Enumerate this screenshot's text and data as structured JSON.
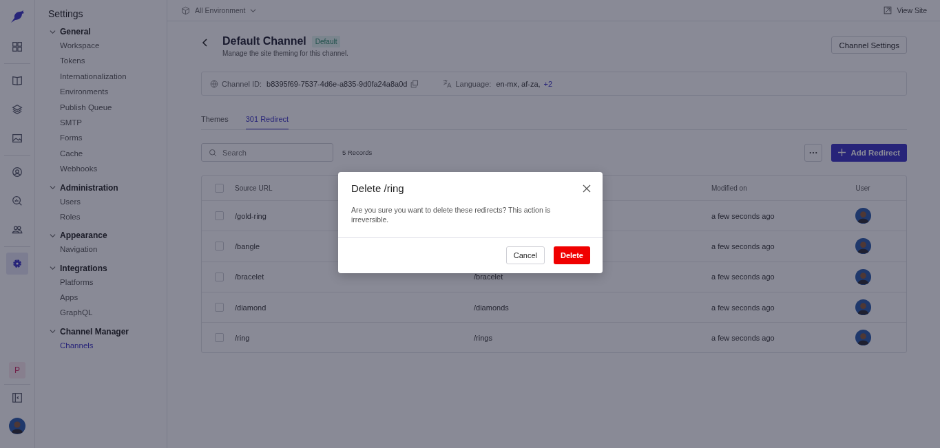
{
  "rail": [
    {
      "kind": "grid",
      "selected": false
    },
    {
      "kind": "book",
      "selected": false
    },
    {
      "kind": "layers",
      "selected": false
    },
    {
      "kind": "image",
      "selected": false
    },
    {
      "kind": "user-circle",
      "selected": false
    },
    {
      "kind": "search-chart",
      "selected": false
    },
    {
      "kind": "users",
      "selected": false
    },
    {
      "kind": "gear",
      "selected": true
    }
  ],
  "workspace_badge": "P",
  "sidebar": {
    "title": "Settings",
    "sections": [
      {
        "title": "General",
        "expanded": true,
        "items": [
          {
            "label": "Workspace",
            "selected": false
          },
          {
            "label": "Tokens",
            "selected": false
          },
          {
            "label": "Internationalization",
            "selected": false
          },
          {
            "label": "Environments",
            "selected": false
          },
          {
            "label": "Publish Queue",
            "selected": false
          },
          {
            "label": "SMTP",
            "selected": false
          },
          {
            "label": "Forms",
            "selected": false
          },
          {
            "label": "Cache",
            "selected": false
          },
          {
            "label": "Webhooks",
            "selected": false
          }
        ]
      },
      {
        "title": "Administration",
        "expanded": true,
        "items": [
          {
            "label": "Users",
            "selected": false
          },
          {
            "label": "Roles",
            "selected": false
          }
        ]
      },
      {
        "title": "Appearance",
        "expanded": true,
        "items": [
          {
            "label": "Navigation",
            "selected": false
          }
        ]
      },
      {
        "title": "Integrations",
        "expanded": true,
        "items": [
          {
            "label": "Platforms",
            "selected": false
          },
          {
            "label": "Apps",
            "selected": false
          },
          {
            "label": "GraphQL",
            "selected": false
          }
        ]
      },
      {
        "title": "Channel Manager",
        "expanded": true,
        "items": [
          {
            "label": "Channels",
            "selected": true
          }
        ]
      }
    ]
  },
  "topbar": {
    "environment": "All Environment",
    "view_site": "View Site"
  },
  "header": {
    "title": "Default Channel",
    "badge": "Default",
    "subtitle": "Manage the site theming for this channel.",
    "settings_button": "Channel Settings"
  },
  "info": {
    "id_label": "Channel ID:",
    "id_value": "b8395f69-7537-4d6e-a835-9d0fa24a8a0d",
    "language_label": "Language:",
    "language_value": "en-mx, af-za,",
    "language_more": "+2"
  },
  "tabs": [
    {
      "label": "Themes",
      "selected": false
    },
    {
      "label": "301 Redirect",
      "selected": true
    }
  ],
  "toolbar": {
    "search_placeholder": "Search",
    "records": "5 Records",
    "add_button": "Add Redirect"
  },
  "table": {
    "columns": [
      "Source URL",
      "Modified on",
      "User"
    ],
    "all_checked": false,
    "rows": [
      {
        "source": "/gold-ring",
        "modified": "a few seconds ago",
        "checked": false
      },
      {
        "source": "/bangle",
        "modified": "a few seconds ago",
        "checked": false
      },
      {
        "source": "/bracelet",
        "destination": "/bracelet",
        "modified": "a few seconds ago",
        "checked": false
      },
      {
        "source": "/diamond",
        "destination": "/diamonds",
        "modified": "a few seconds ago",
        "checked": false
      },
      {
        "source": "/ring",
        "destination": "/rings",
        "modified": "a few seconds ago",
        "checked": false
      }
    ]
  },
  "dialog": {
    "title": "Delete /ring",
    "message": "Are you sure you want to delete these redirects? This action is irreversible.",
    "cancel": "Cancel",
    "confirm": "Delete"
  }
}
